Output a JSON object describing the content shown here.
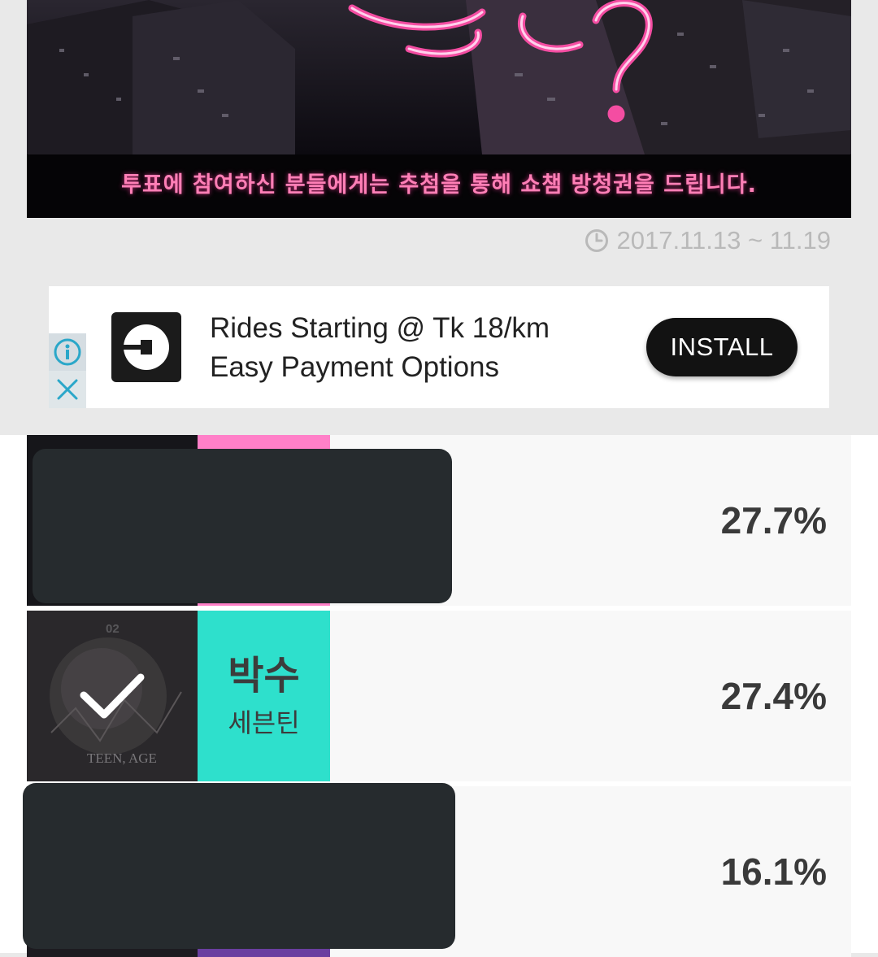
{
  "banner": {
    "caption": "투표에 참여하신 분들에게는 추첨을 통해 쇼챔 방청권을 드립니다."
  },
  "vote_period": "2017.11.13 ~ 11.19",
  "ad": {
    "line1": "Rides Starting @ Tk 18/km",
    "line2": "Easy Payment Options",
    "install_label": "INSTALL",
    "info_icon": "info-icon",
    "close_icon": "close-icon"
  },
  "results": [
    {
      "title": "",
      "artist": "",
      "percent": "27.7%",
      "color": "#ff80c8",
      "selected": false,
      "redacted": true
    },
    {
      "title": "박수",
      "artist": "세븐틴",
      "percent": "27.4%",
      "color": "#2ee0cc",
      "selected": true,
      "redacted": false,
      "album_text": "TEEN, AGE",
      "album_number": "02"
    },
    {
      "title": "",
      "artist": "",
      "percent": "16.1%",
      "color": "#6a3fa0",
      "selected": false,
      "redacted": true
    }
  ],
  "colors": {
    "accent_pink": "#ff80c8",
    "accent_teal": "#2ee0cc",
    "redaction": "#262b2e"
  }
}
